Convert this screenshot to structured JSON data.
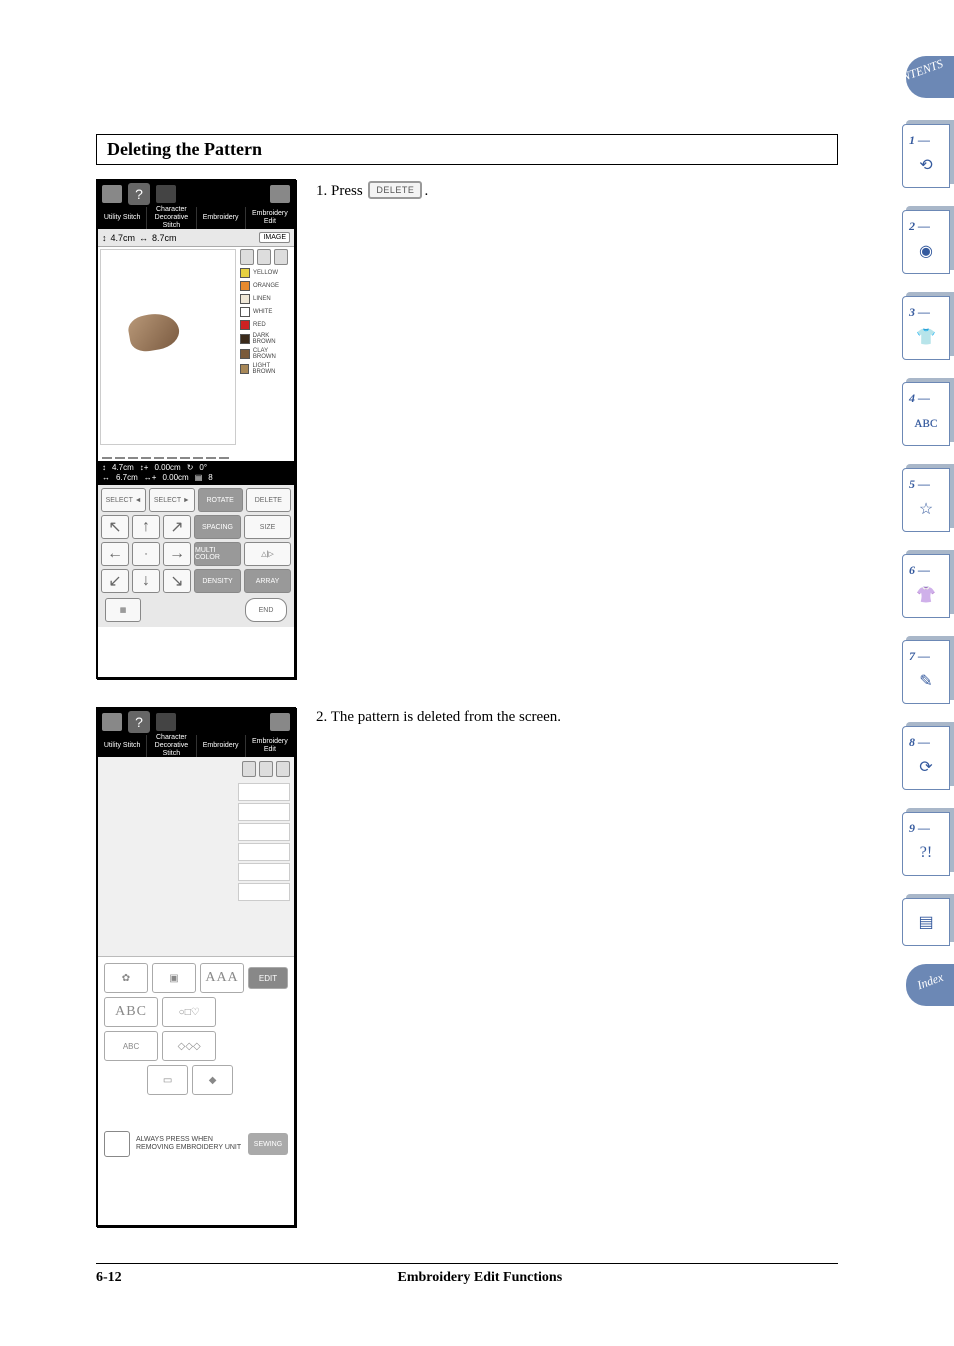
{
  "heading": "Deleting the Pattern",
  "step1": {
    "num": "1.",
    "text_pre": "Press",
    "btn": "DELETE",
    "text_post": "."
  },
  "step2": {
    "num": "2.",
    "text": "The pattern is deleted from the screen."
  },
  "footer": {
    "page": "6-12",
    "title": "Embroidery Edit Functions"
  },
  "screen1": {
    "tabs": [
      "Utility Stitch",
      "Character Decorative Stitch",
      "Embroidery",
      "Embroidery Edit"
    ],
    "dim_h": "4.7cm",
    "dim_w": "8.7cm",
    "image_btn": "IMAGE",
    "colors": [
      "YELLOW",
      "ORANGE",
      "LINEN",
      "WHITE",
      "RED",
      "DARK BROWN",
      "CLAY BROWN",
      "LIGHT BROWN"
    ],
    "info": {
      "h": "4.7cm",
      "w": "6.7cm",
      "dx": "0.00cm",
      "dy": "0.00cm",
      "rot": "0°",
      "ct": "8"
    },
    "btns": {
      "sel_prev": "SELECT ◄",
      "sel_next": "SELECT ►",
      "rotate": "ROTATE",
      "delete": "DELETE",
      "spacing": "SPACING",
      "size": "SIZE",
      "multi": "MULTI COLOR",
      "mirror": "△|▷",
      "density": "DENSITY",
      "array": "ARRAY",
      "end": "END"
    }
  },
  "screen2": {
    "tabs": [
      "Utility Stitch",
      "Character Decorative Stitch",
      "Embroidery",
      "Embroidery Edit"
    ],
    "cats": {
      "aaa": "AAA",
      "abc": "ABC",
      "shapes": "○□♡",
      "abc2": "ABC",
      "frames": "◇◇◇",
      "edit": "EDIT"
    },
    "msg": "ALWAYS PRESS WHEN REMOVING EMBROIDERY UNIT",
    "sewing": "SEWING"
  },
  "sidetabs": {
    "contents": "CONTENTS",
    "index": "Index",
    "nums": [
      "1 —",
      "2 —",
      "3 —",
      "4 —",
      "5 —",
      "6 —",
      "7 —",
      "8 —",
      "9 —"
    ]
  }
}
